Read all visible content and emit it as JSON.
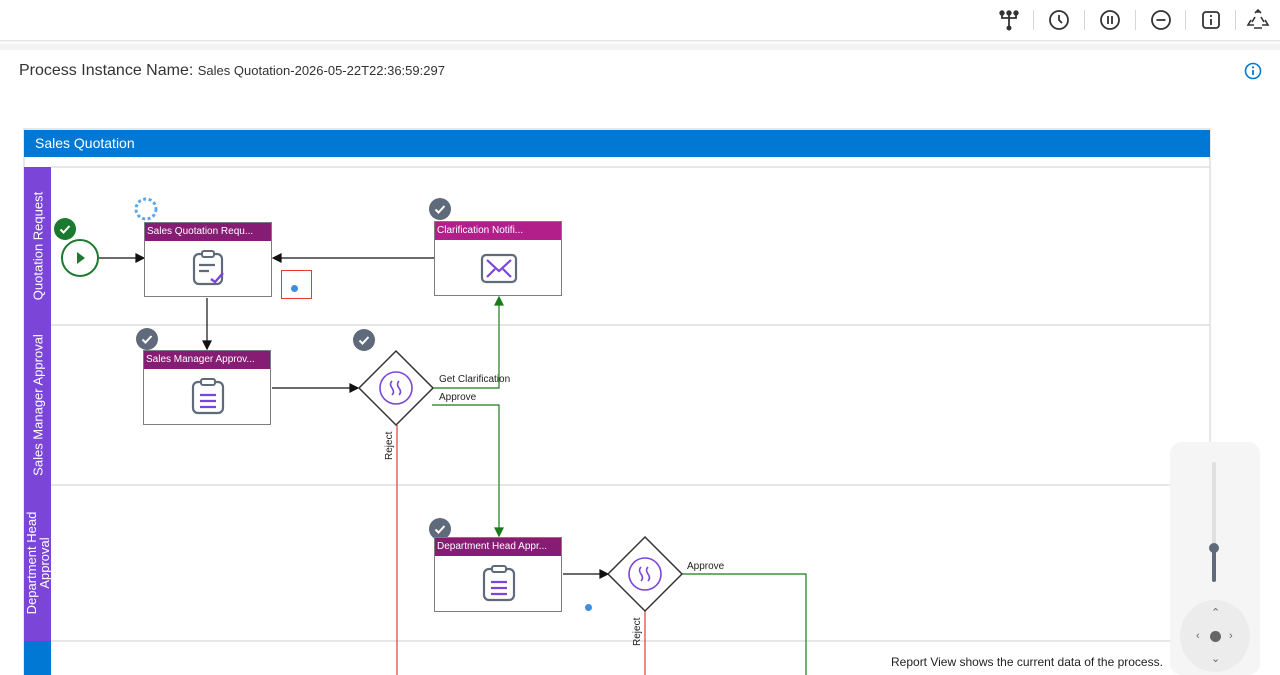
{
  "toolbar": {
    "buttons": [
      {
        "name": "hierarchy-icon",
        "label": "Hierarchy"
      },
      {
        "name": "history-icon",
        "label": "History"
      },
      {
        "name": "pause-icon",
        "label": "Pause"
      },
      {
        "name": "stop-icon",
        "label": "Stop"
      },
      {
        "name": "info-square-icon",
        "label": "Info"
      },
      {
        "name": "recycle-icon",
        "label": "Recycle"
      }
    ]
  },
  "process_instance": {
    "label": "Process Instance Name:",
    "value": "Sales Quotation-2026-05-22T22:36:59:297"
  },
  "pool": {
    "title": "Sales Quotation",
    "lanes": [
      {
        "label": "Quotation Request"
      },
      {
        "label": "Sales Manager Approval"
      },
      {
        "label": "Department Head Approval"
      }
    ]
  },
  "tasks": {
    "sales_quotation_request": "Sales Quotation Requ...",
    "clarification_notification": "Clarification Notifi...",
    "sales_manager_approval": "Sales Manager Approv...",
    "department_head_approval": "Department Head Appr..."
  },
  "flow_labels": {
    "get_clarification": "Get Clarification",
    "approve_1": "Approve",
    "reject_1": "Reject",
    "approve_2": "Approve",
    "reject_2": "Reject"
  },
  "footer": {
    "note": "Report View shows the current data of the process."
  },
  "colors": {
    "pool_blue": "#0078d4",
    "lane_purple": "#7b46d8",
    "task_header_plum": "#861c73",
    "task_header_pink": "#b21f8b",
    "flow_green": "#1b7a1b",
    "flow_red": "#e53935",
    "badge_gray": "#5f6a7a",
    "badge_green": "#1b7a2f"
  },
  "zoom": {
    "level_fraction": 0.28
  }
}
